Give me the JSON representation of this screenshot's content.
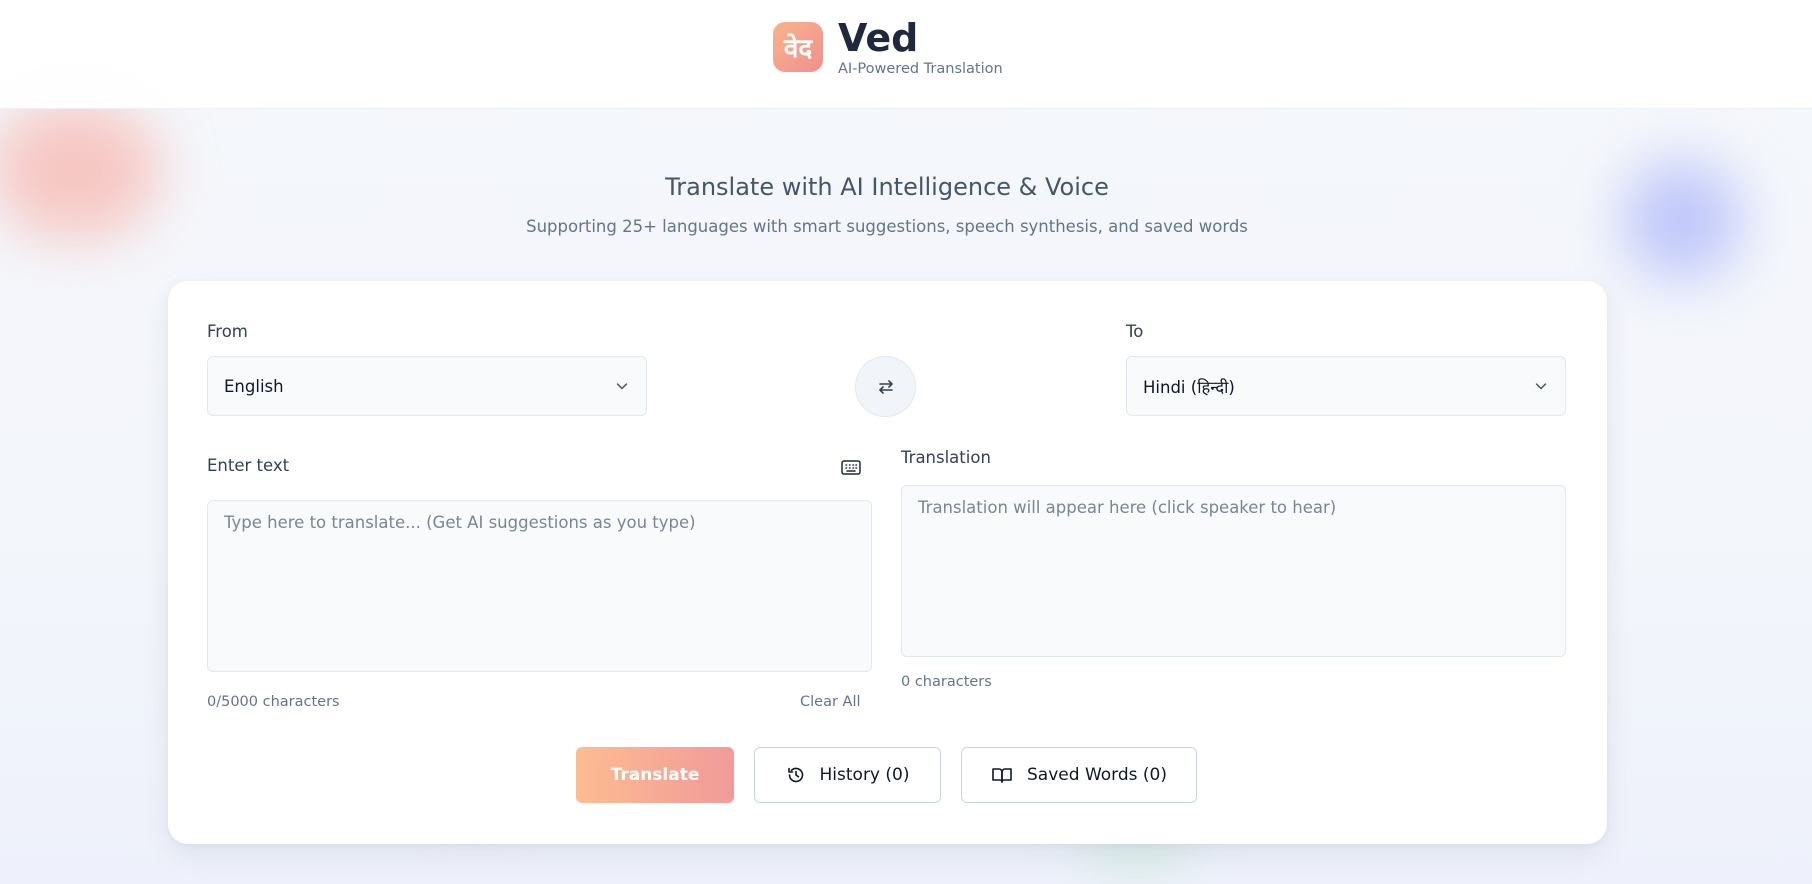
{
  "header": {
    "logo_text": "वेद",
    "app_name": "Ved",
    "tagline": "AI-Powered Translation"
  },
  "hero": {
    "title": "Translate with AI Intelligence & Voice",
    "subtitle": "Supporting 25+ languages with smart suggestions, speech synthesis, and saved words"
  },
  "translator": {
    "from_label": "From",
    "from_value": "English",
    "to_label": "To",
    "to_value": "Hindi (हिन्दी)",
    "input_label": "Enter text",
    "input_placeholder": "Type here to translate... (Get AI suggestions as you type)",
    "input_value": "",
    "char_count": "0/5000 characters",
    "clear_label": "Clear All",
    "output_label": "Translation",
    "output_placeholder": "Translation will appear here (click speaker to hear)",
    "output_char_count": "0 characters"
  },
  "actions": {
    "translate_label": "Translate",
    "history_label": "History (0)",
    "saved_label": "Saved Words (0)"
  },
  "icons": {
    "swap": "swap-arrows-icon",
    "keyboard": "keyboard-icon",
    "history": "history-icon",
    "saved": "book-open-icon",
    "chevron": "chevron-down-icon"
  },
  "colors": {
    "accent_start": "#fcb98c",
    "accent_end": "#f19595",
    "text_primary": "#1e293b",
    "text_muted": "#64748b"
  }
}
